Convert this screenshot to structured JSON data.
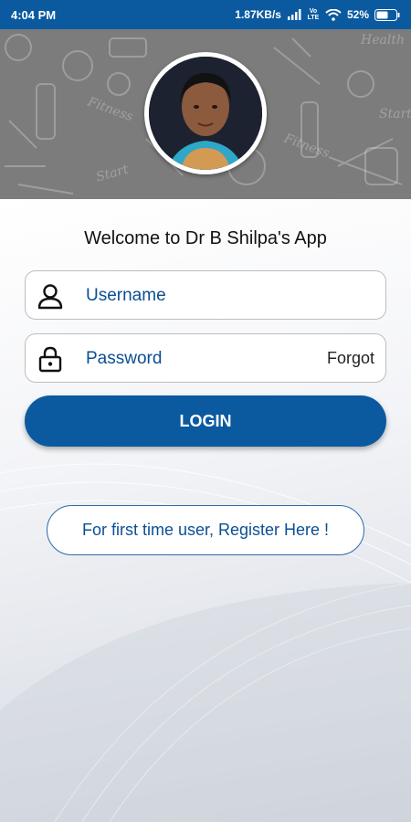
{
  "status_bar": {
    "time": "4:04 PM",
    "network_speed": "1.87KB/s",
    "lte_label": "Vo LTE",
    "battery": "52%"
  },
  "header": {
    "doodle_words": [
      "Health",
      "Fitness",
      "Start",
      "Fitness",
      "Start"
    ],
    "icons": [
      "profile-photo"
    ]
  },
  "welcome_text": "Welcome to Dr B Shilpa's App",
  "login_form": {
    "username_placeholder": "Username",
    "password_placeholder": "Password",
    "forgot_label": "Forgot",
    "login_label": "LOGIN"
  },
  "register_label": "For first time user, Register Here !",
  "colors": {
    "primary": "#0b5aa0",
    "text_blue": "#0b4f93",
    "header_gray": "#7c7c7c"
  }
}
